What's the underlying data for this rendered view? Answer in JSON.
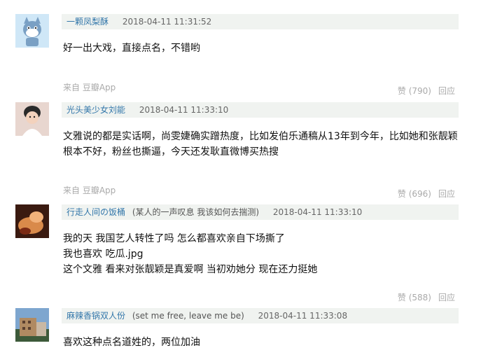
{
  "source_prefix": "来自",
  "comments": [
    {
      "author": "一颗凤梨酥",
      "signature": "",
      "time": "2018-04-11 11:31:52",
      "lines": [
        "好一出大戏，直接点名，不错哟"
      ],
      "source_app": "豆瓣App",
      "vote_label": "赞 (790)",
      "reply_label": "回应",
      "avatar_colors": [
        "#cfe7f7",
        "#7aa0c4"
      ]
    },
    {
      "author": "光头美少女刘能",
      "signature": "",
      "time": "2018-04-11 11:33:10",
      "lines": [
        "文雅说的都是实话啊，尚雯婕确实蹭热度，比如发伯乐通稿从13年到今年，比如她和张靓颖",
        "根本不好，粉丝也撕逼，今天还发耿直微博买热搜"
      ],
      "source_app": "豆瓣App",
      "vote_label": "赞 (696)",
      "reply_label": "回应",
      "avatar_colors": [
        "#e8d6cf",
        "#2a2a2a"
      ]
    },
    {
      "author": "行走人间の饭桶",
      "signature": "(某人的一声叹息 我该如何去揣测)",
      "time": "2018-04-11 11:33:10",
      "lines": [
        "我的天 我国艺人转性了吗 怎么都喜欢亲自下场撕了",
        "我也喜欢 吃瓜.jpg",
        "这个文雅 看来对张靓颖是真爱啊 当初劝她分 现在还力挺她"
      ],
      "source_app": "",
      "vote_label": "赞 (588)",
      "reply_label": "回应",
      "avatar_colors": [
        "#3a1a10",
        "#d98a4a"
      ]
    },
    {
      "author": "麻辣香锅双人份",
      "signature": "(set me free, leave me be)",
      "time": "2018-04-11 11:33:08",
      "lines": [
        "喜欢这种点名道姓的，两位加油"
      ],
      "source_app": "",
      "vote_label": "",
      "reply_label": "",
      "avatar_colors": [
        "#7ea6cf",
        "#b08a62"
      ]
    }
  ]
}
